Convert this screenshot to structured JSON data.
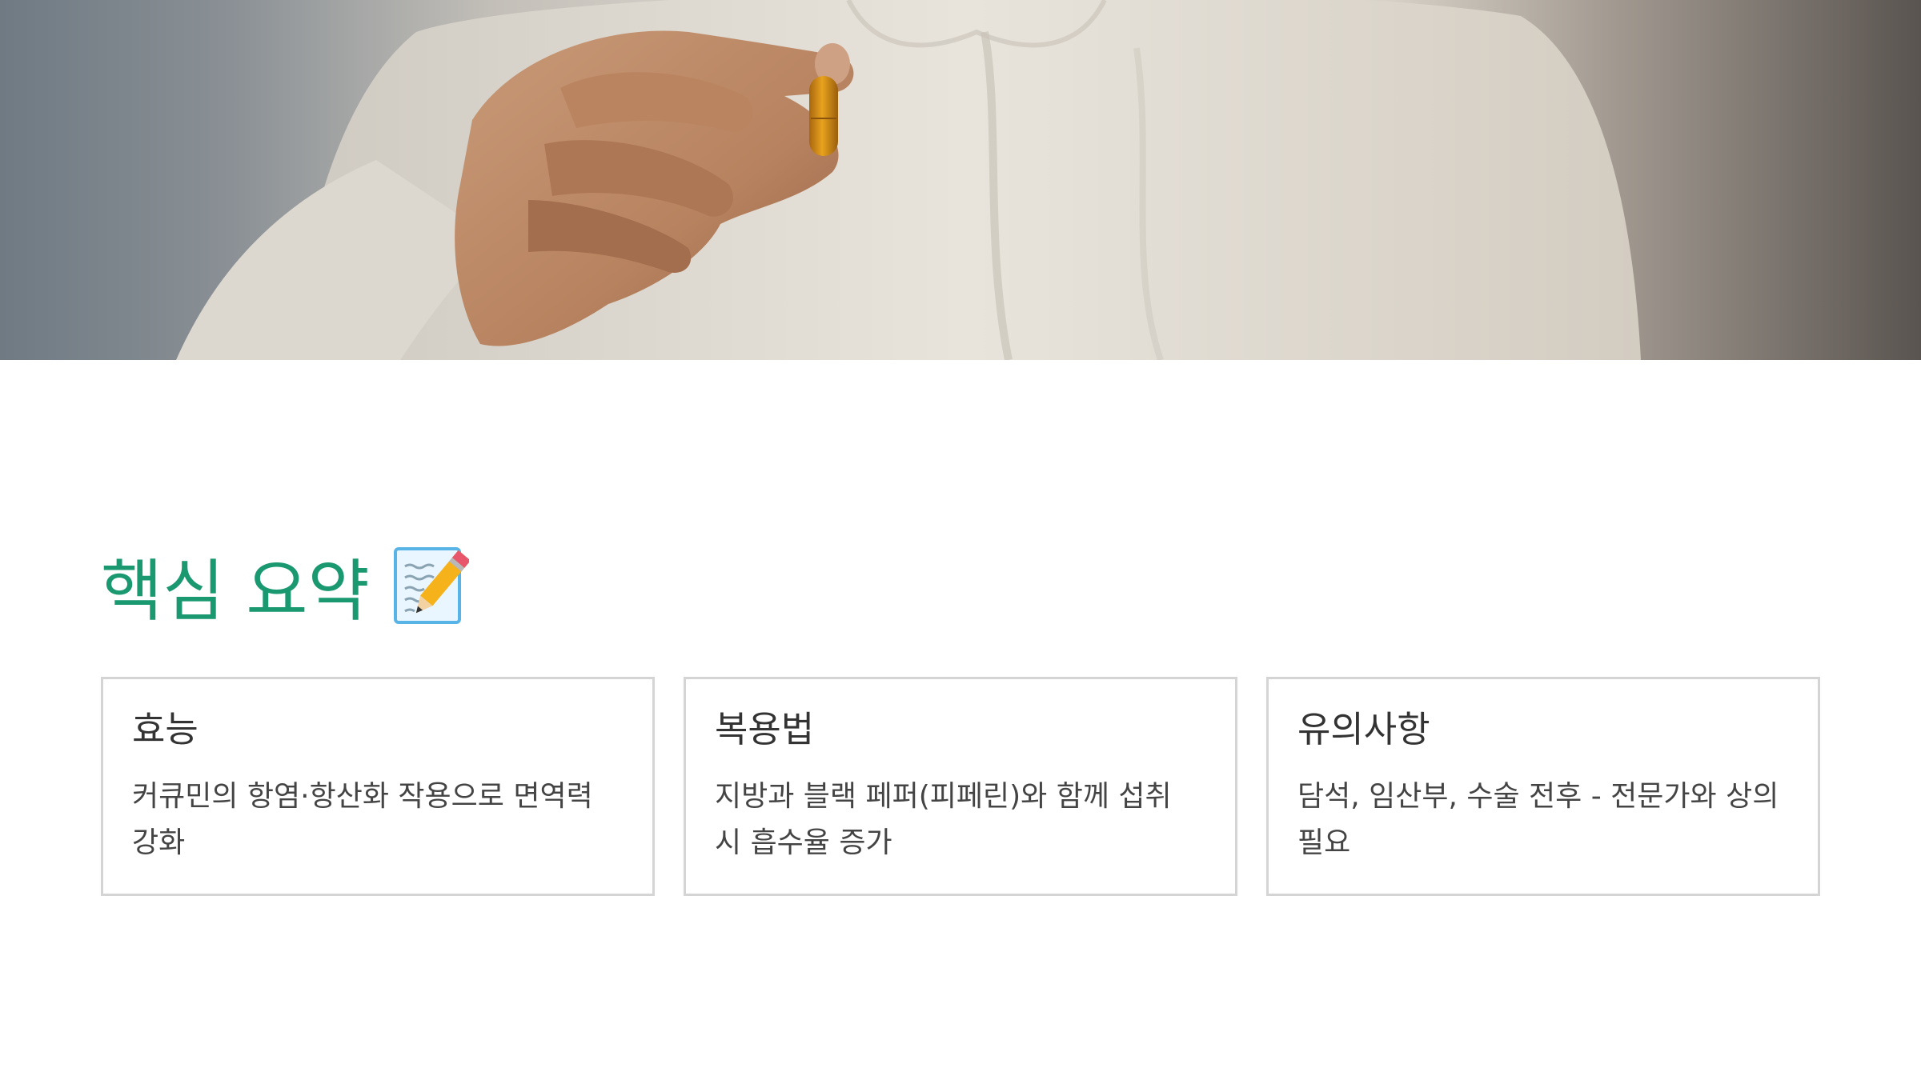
{
  "hero": {
    "image_description_icon": "hand-holding-turmeric-capsule-photo"
  },
  "summary": {
    "title": "핵심 요약",
    "title_icon": "memo-icon",
    "accent_color": "#1a9870",
    "cards": [
      {
        "title": "효능",
        "text": "커큐민의 항염·항산화 작용으로 면역력 강화"
      },
      {
        "title": "복용법",
        "text": "지방과 블랙 페퍼(피페린)와 함께 섭취 시 흡수율 증가"
      },
      {
        "title": "유의사항",
        "text": "담석, 임산부, 수술 전후 - 전문가와 상의 필요"
      }
    ]
  }
}
